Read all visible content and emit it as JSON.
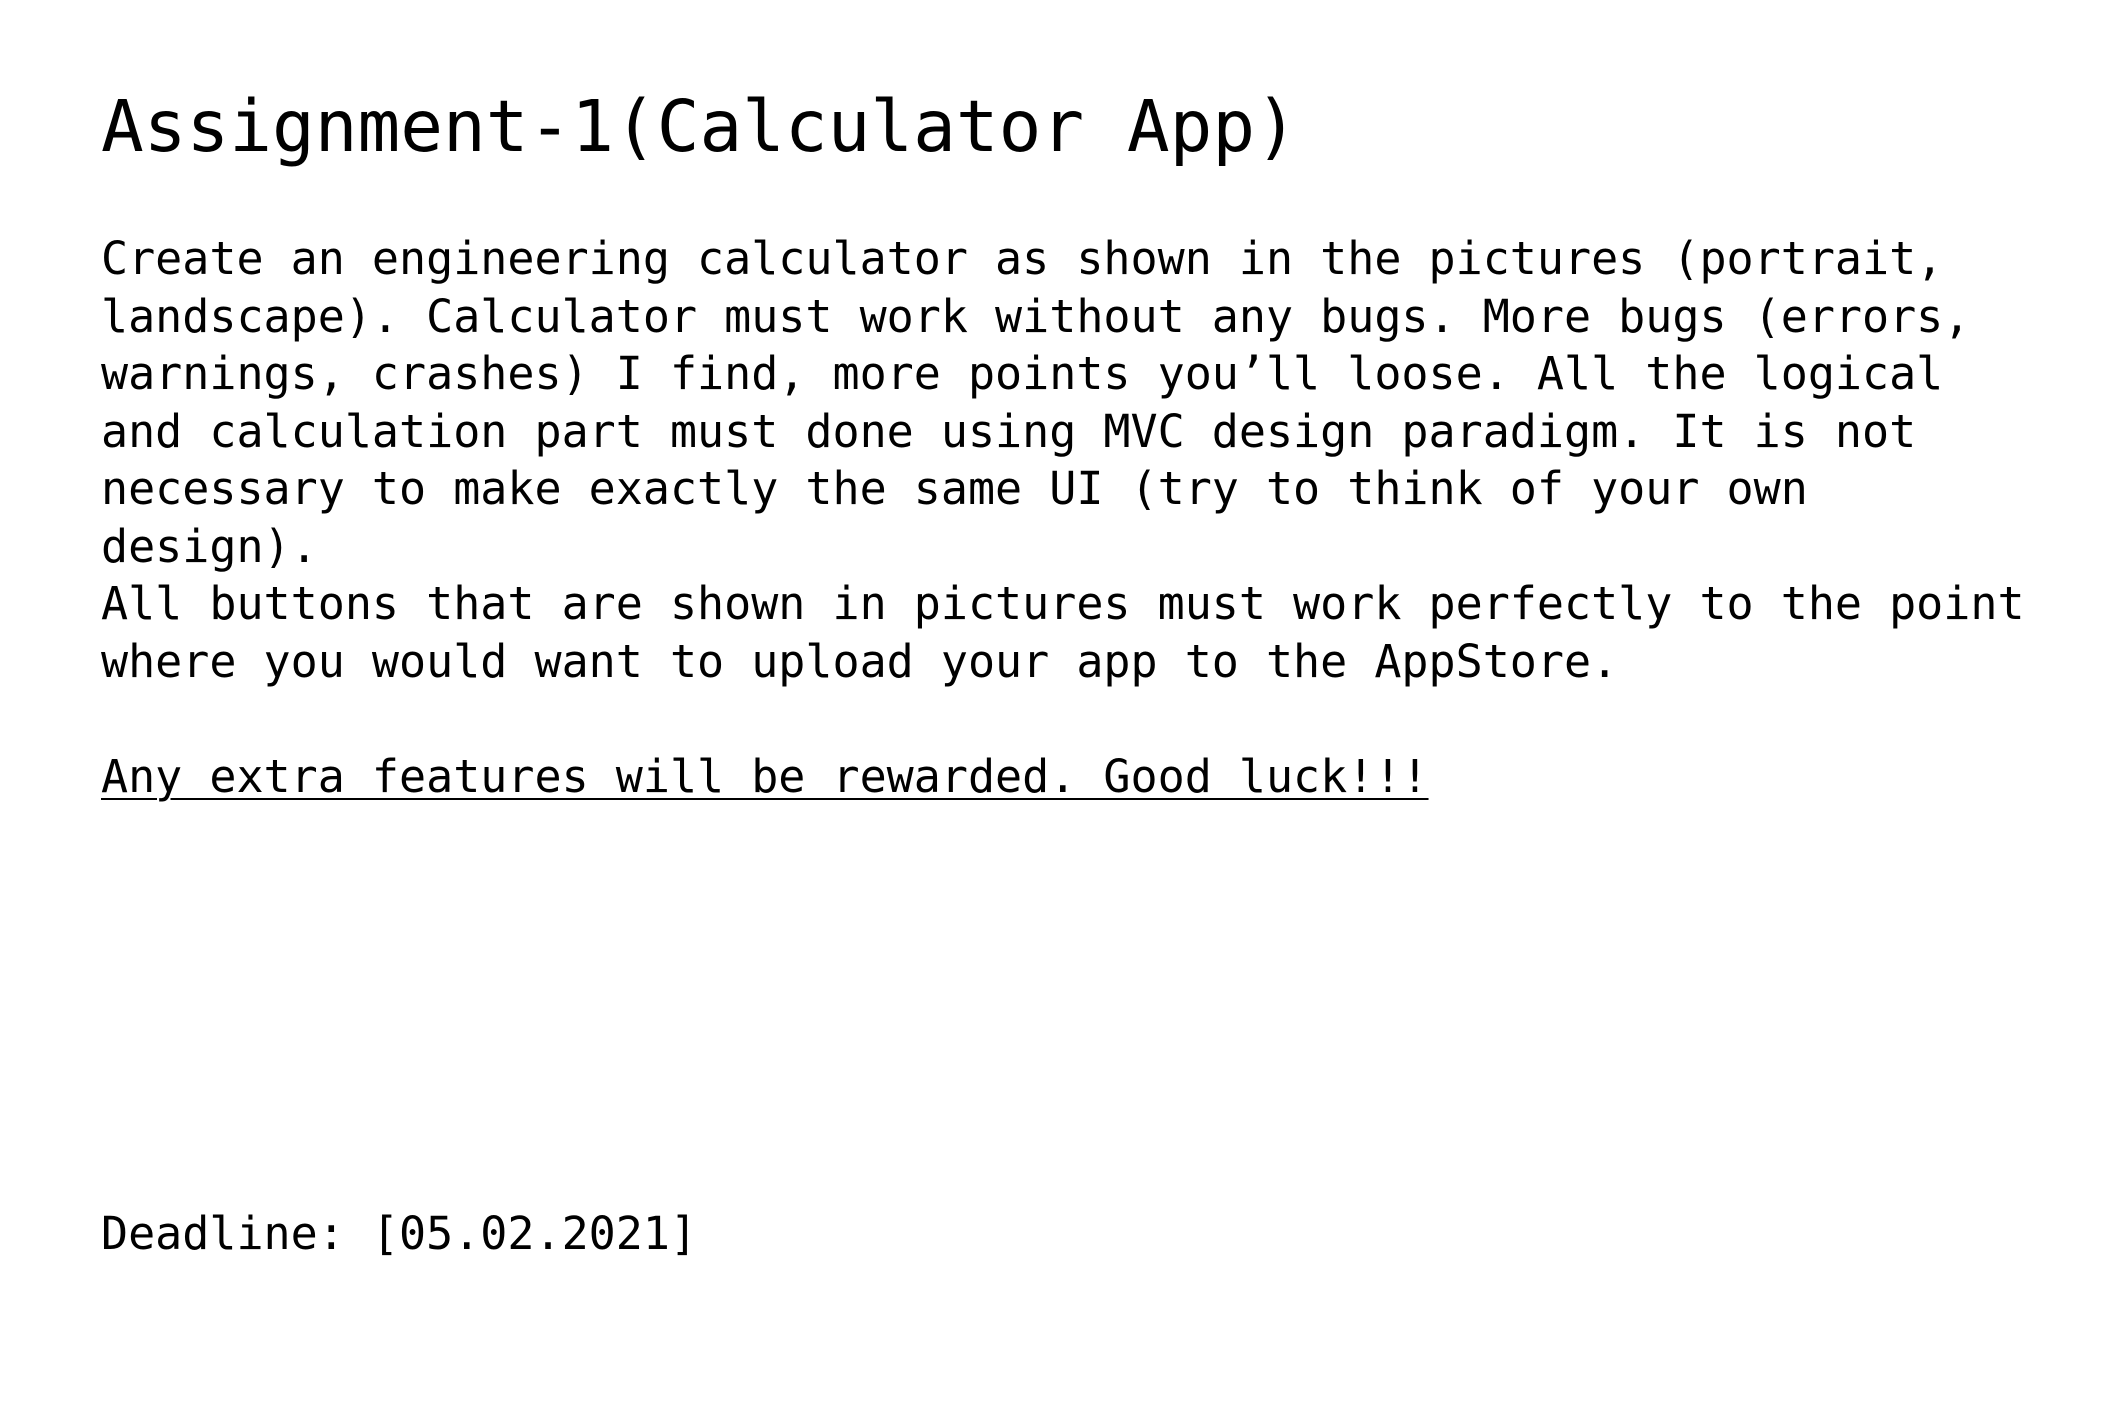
{
  "document": {
    "title": "Assignment-1(Calculator App)",
    "paragraph_1": "Create an engineering calculator as shown in the pictures (portrait,\nlandscape). Calculator must work without any bugs. More bugs (errors,\nwarnings, crashes) I find, more points you’ll loose. All the logical\nand calculation part must done using MVC design paradigm. It is not\nnecessary to make exactly the same UI (try to think of your own\ndesign).",
    "paragraph_2": "All buttons that are shown in pictures must work perfectly to the point\nwhere you would want to upload your app to the AppStore.",
    "extra_features_note": "Any extra features will be rewarded. Good luck!!!",
    "deadline": "Deadline: [05.02.2021]"
  }
}
